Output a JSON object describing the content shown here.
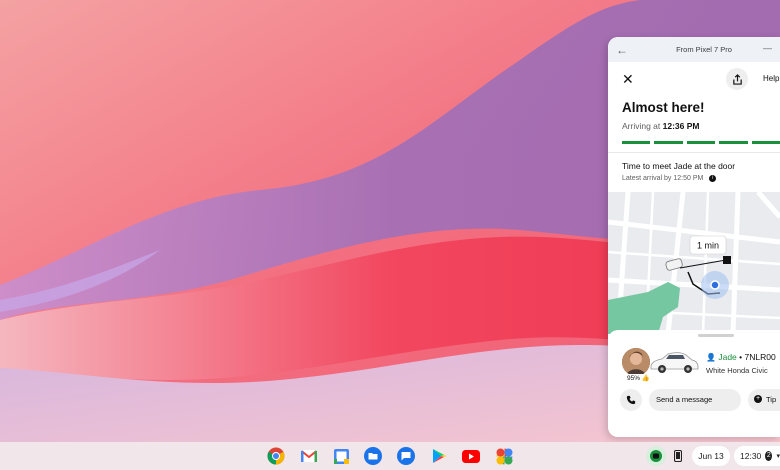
{
  "window": {
    "title": "From Pixel 7 Pro"
  },
  "app": {
    "help_label": "Help",
    "status_title": "Almost here!",
    "arriving_prefix": "Arriving at",
    "arriving_time": "12:36 PM",
    "progress_segments": 5,
    "meet_text": "Time to meet Jade at the door",
    "latest_arrival": "Latest arrival by 12:50 PM",
    "map_eta": "1 min",
    "driver": {
      "name": "Jade",
      "plate": "• 7NLR00",
      "car": "White Honda Civic",
      "rating": "95% 👍"
    },
    "actions": {
      "message_label": "Send a message",
      "tip_label": "Tip"
    }
  },
  "shelf": {
    "apps": [
      "chrome-icon",
      "gmail-icon",
      "calendar-icon",
      "files-icon",
      "messages-icon",
      "play-store-icon",
      "youtube-icon",
      "photos-icon"
    ],
    "date": "Jun 13",
    "time": "12:30",
    "notification_count": "2"
  },
  "colors": {
    "accent_green": "#1a8f3c"
  }
}
